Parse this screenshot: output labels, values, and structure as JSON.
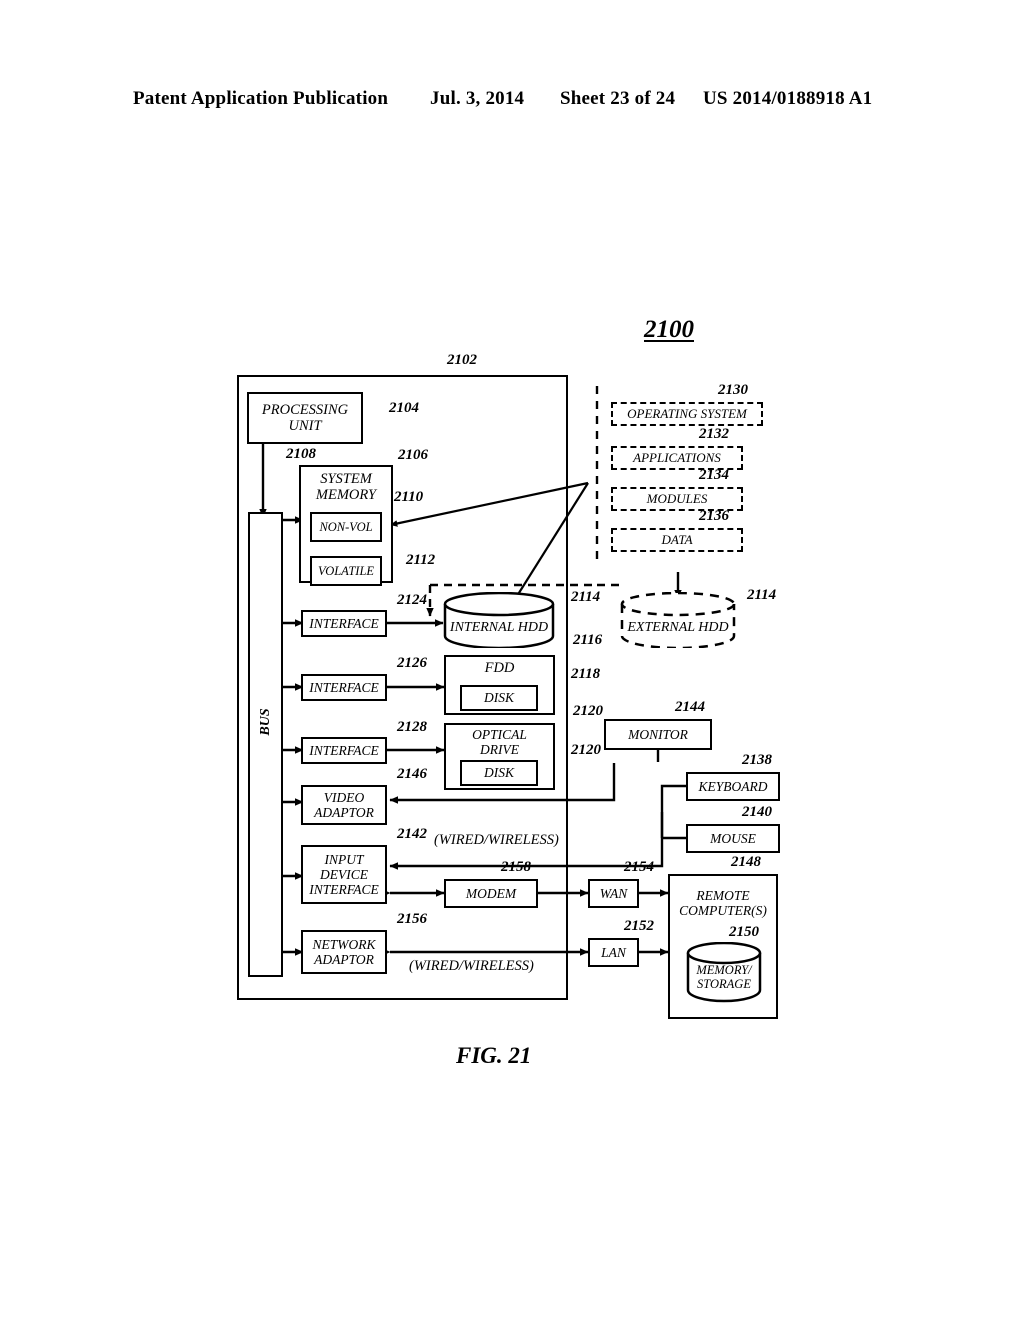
{
  "header": {
    "publication": "Patent Application Publication",
    "date": "Jul. 3, 2014",
    "sheet": "Sheet 23 of 24",
    "patent_number": "US 2014/0188918 A1"
  },
  "figure": {
    "number": "2100",
    "caption": "FIG. 21"
  },
  "blocks": {
    "computer_outer": "",
    "processing_unit": "PROCESSING\nUNIT",
    "system_memory": "SYSTEM\nMEMORY",
    "non_vol": "NON-VOL",
    "volatile": "VOLATILE",
    "bus": "BUS",
    "interface_hdd": "INTERFACE",
    "interface_fdd": "INTERFACE",
    "interface_optical": "INTERFACE",
    "internal_hdd": "INTERNAL HDD",
    "external_hdd": "EXTERNAL HDD",
    "fdd": "FDD",
    "fdd_disk": "DISK",
    "optical_drive": "OPTICAL\nDRIVE",
    "optical_disk": "DISK",
    "video_adaptor": "VIDEO\nADAPTOR",
    "input_device_interface": "INPUT\nDEVICE\nINTERFACE",
    "network_adaptor": "NETWORK\nADAPTOR",
    "modem": "MODEM",
    "monitor": "MONITOR",
    "keyboard": "KEYBOARD",
    "mouse": "MOUSE",
    "wan": "WAN",
    "lan": "LAN",
    "remote_computers": "REMOTE\nCOMPUTER(S)",
    "memory_storage": "MEMORY/\nSTORAGE",
    "operating_system": "OPERATING SYSTEM",
    "applications": "APPLICATIONS",
    "modules": "MODULES",
    "data": "DATA"
  },
  "annotations": {
    "wired_wireless_upper": "(WIRED/WIRELESS)",
    "wired_wireless_lower": "(WIRED/WIRELESS)"
  },
  "refs": {
    "r2102": "2102",
    "r2104": "2104",
    "r2106": "2106",
    "r2108": "2108",
    "r2110": "2110",
    "r2112": "2112",
    "r2114a": "2114",
    "r2114b": "2114",
    "r2116": "2116",
    "r2118": "2118",
    "r2120a": "2120",
    "r2120b": "2120",
    "r2124": "2124",
    "r2126": "2126",
    "r2128": "2128",
    "r2130": "2130",
    "r2132": "2132",
    "r2134": "2134",
    "r2136": "2136",
    "r2138": "2138",
    "r2140": "2140",
    "r2142": "2142",
    "r2144": "2144",
    "r2146": "2146",
    "r2148": "2148",
    "r2150": "2150",
    "r2152": "2152",
    "r2154": "2154",
    "r2156": "2156",
    "r2158": "2158"
  },
  "colors": {
    "ink": "#000000",
    "paper": "#ffffff"
  }
}
